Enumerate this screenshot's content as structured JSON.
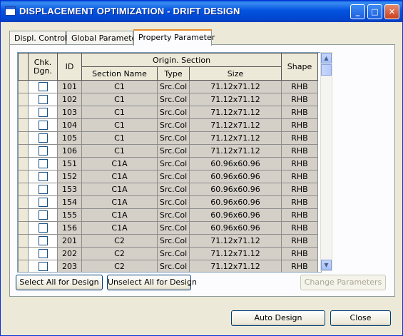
{
  "window": {
    "title": "DISPLACEMENT OPTIMIZATION - DRIFT DESIGN"
  },
  "titlebar_buttons": {
    "minimize": "_",
    "maximize": "□",
    "close": "✕"
  },
  "tabs": [
    {
      "label": "Displ. Control",
      "active": false
    },
    {
      "label": "Global Parameter",
      "active": false
    },
    {
      "label": "Property Parameter",
      "active": true
    }
  ],
  "table": {
    "headers": {
      "chk": "Chk.\nDgn.",
      "id": "ID",
      "group": "Origin. Section",
      "section_name": "Section Name",
      "type": "Type",
      "size": "Size",
      "shape": "Shape"
    },
    "rows": [
      {
        "id": "101",
        "section": "C1",
        "type": "Src.Col",
        "size": "71.12x71.12",
        "shape": "RHB",
        "checked": false
      },
      {
        "id": "102",
        "section": "C1",
        "type": "Src.Col",
        "size": "71.12x71.12",
        "shape": "RHB",
        "checked": false
      },
      {
        "id": "103",
        "section": "C1",
        "type": "Src.Col",
        "size": "71.12x71.12",
        "shape": "RHB",
        "checked": false
      },
      {
        "id": "104",
        "section": "C1",
        "type": "Src.Col",
        "size": "71.12x71.12",
        "shape": "RHB",
        "checked": false
      },
      {
        "id": "105",
        "section": "C1",
        "type": "Src.Col",
        "size": "71.12x71.12",
        "shape": "RHB",
        "checked": false
      },
      {
        "id": "106",
        "section": "C1",
        "type": "Src.Col",
        "size": "71.12x71.12",
        "shape": "RHB",
        "checked": false
      },
      {
        "id": "151",
        "section": "C1A",
        "type": "Src.Col",
        "size": "60.96x60.96",
        "shape": "RHB",
        "checked": false
      },
      {
        "id": "152",
        "section": "C1A",
        "type": "Src.Col",
        "size": "60.96x60.96",
        "shape": "RHB",
        "checked": false
      },
      {
        "id": "153",
        "section": "C1A",
        "type": "Src.Col",
        "size": "60.96x60.96",
        "shape": "RHB",
        "checked": false
      },
      {
        "id": "154",
        "section": "C1A",
        "type": "Src.Col",
        "size": "60.96x60.96",
        "shape": "RHB",
        "checked": false
      },
      {
        "id": "155",
        "section": "C1A",
        "type": "Src.Col",
        "size": "60.96x60.96",
        "shape": "RHB",
        "checked": false
      },
      {
        "id": "156",
        "section": "C1A",
        "type": "Src.Col",
        "size": "60.96x60.96",
        "shape": "RHB",
        "checked": false
      },
      {
        "id": "201",
        "section": "C2",
        "type": "Src.Col",
        "size": "71.12x71.12",
        "shape": "RHB",
        "checked": false
      },
      {
        "id": "202",
        "section": "C2",
        "type": "Src.Col",
        "size": "71.12x71.12",
        "shape": "RHB",
        "checked": false
      },
      {
        "id": "203",
        "section": "C2",
        "type": "Src.Col",
        "size": "71.12x71.12",
        "shape": "RHB",
        "checked": false
      }
    ]
  },
  "scrollbar": {
    "up": "▲",
    "down": "▼"
  },
  "buttons": {
    "select_all": "Select All for Design",
    "unselect_all": "Unselect All for Design",
    "change_parameters": "Change Parameters",
    "auto_design": "Auto Design",
    "close": "Close"
  }
}
